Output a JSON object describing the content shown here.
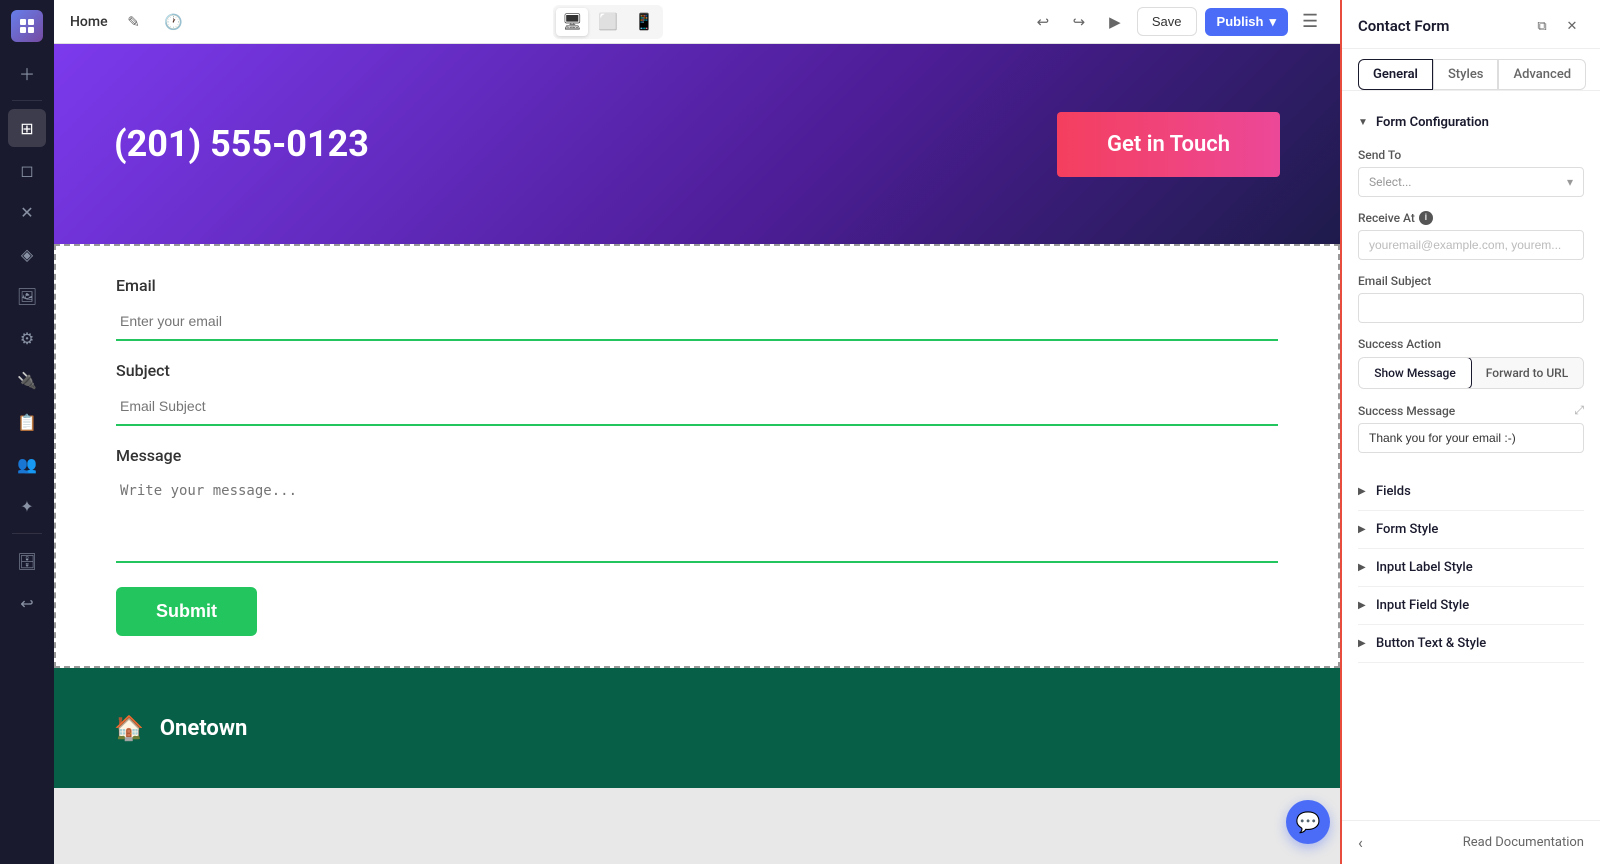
{
  "topbar": {
    "home_label": "Home",
    "save_label": "Save",
    "publish_label": "Publish",
    "devices": [
      "desktop",
      "tablet",
      "mobile"
    ]
  },
  "hero": {
    "phone": "(201) 555-0123",
    "cta_button": "Get in Touch"
  },
  "form": {
    "email_label": "Email",
    "email_placeholder": "Enter your email",
    "subject_label": "Subject",
    "subject_placeholder": "Email Subject",
    "message_label": "Message",
    "message_placeholder": "Write your message...",
    "submit_label": "Submit"
  },
  "footer": {
    "brand_name": "Onetown"
  },
  "panel": {
    "title": "Contact Form",
    "tabs": [
      "General",
      "Styles",
      "Advanced"
    ],
    "active_tab": "General",
    "form_config_label": "Form Configuration",
    "send_to_label": "Send To",
    "send_to_placeholder": "Select...",
    "receive_at_label": "Receive At",
    "receive_at_placeholder": "youremail@example.com, yourem...",
    "email_subject_label": "Email Subject",
    "email_subject_value": "",
    "success_action_label": "Success Action",
    "success_action_buttons": [
      "Show Message",
      "Forward to URL"
    ],
    "active_success_action": "Show Message",
    "success_message_label": "Success Message",
    "success_message_value": "Thank you for your email :-)",
    "fields_label": "Fields",
    "form_style_label": "Form Style",
    "input_label_style_label": "Input Label Style",
    "input_field_style_label": "Input Field Style",
    "button_text_style_label": "Button Text & Style",
    "read_documentation_label": "Read Documentation"
  }
}
